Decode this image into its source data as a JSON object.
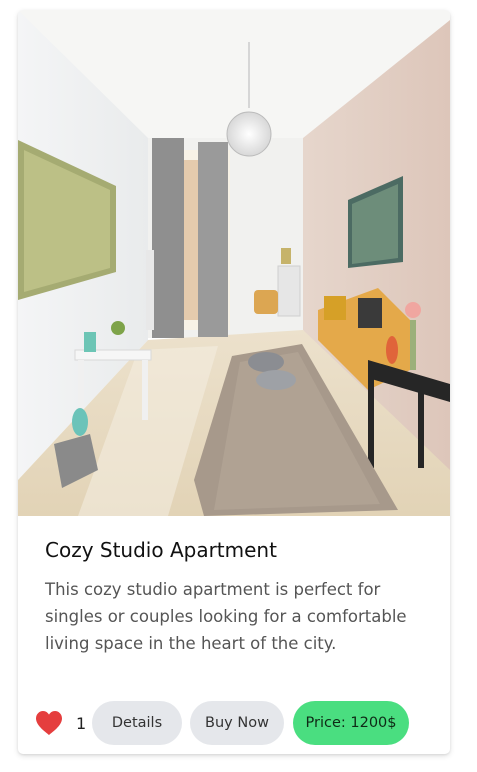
{
  "listing": {
    "title": "Cozy Studio Apartment",
    "description": "This cozy studio apartment is perfect for singles or couples looking for a comfortable living space in the heart of the city.",
    "likes": "1",
    "details_label": "Details",
    "buy_label": "Buy Now",
    "price_label": "Price: 1200$",
    "like_icon": "heart-icon"
  },
  "colors": {
    "heart": "#e53e3e",
    "button_bg": "#e5e7eb",
    "price_bg": "#4ade80"
  }
}
